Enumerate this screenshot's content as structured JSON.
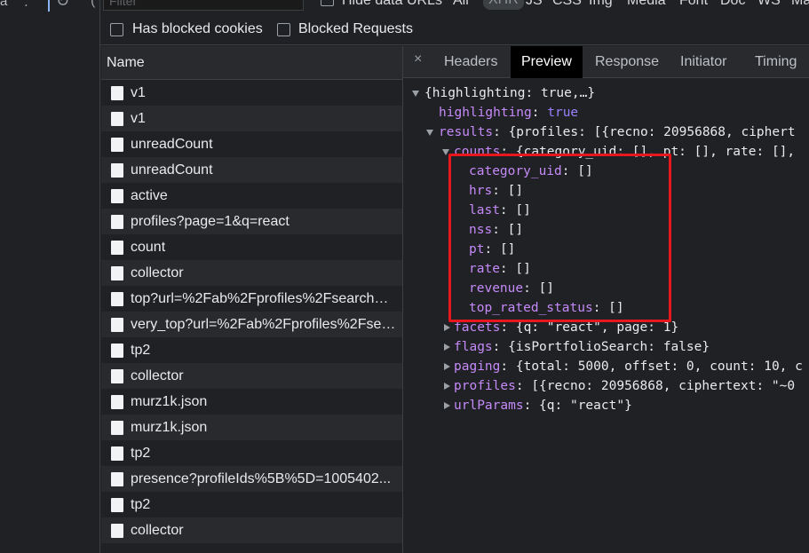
{
  "left_toolbar": {
    "text": "a",
    "dots": "⁚",
    "refresh_glyph": "↻",
    "extra_glyph": "("
  },
  "filter": {
    "placeholder": "Filter",
    "hide_data_urls_label": "Hide data URLs"
  },
  "type_filters": [
    "All",
    "XHR",
    "JS",
    "CSS",
    "Img",
    "Media",
    "Font",
    "Doc",
    "WS",
    "Ma"
  ],
  "active_type_filter": "XHR",
  "checkboxes": {
    "blocked_cookies": "Has blocked cookies",
    "blocked_requests": "Blocked Requests"
  },
  "name_column_header": "Name",
  "requests": [
    "v1",
    "v1",
    "unreadCount",
    "unreadCount",
    "active",
    "profiles?page=1&q=react",
    "count",
    "collector",
    "top?url=%2Fab%2Fprofiles%2Fsearch%...",
    "very_top?url=%2Fab%2Fprofiles%2Fsea...",
    "tp2",
    "collector",
    "murz1k.json",
    "murz1k.json",
    "tp2",
    "presence?profileIds%5B%5D=1005402...",
    "tp2",
    "collector"
  ],
  "detail_tabs": {
    "close": "×",
    "headers": "Headers",
    "preview": "Preview",
    "response": "Response",
    "initiator": "Initiator",
    "timing": "Timing"
  },
  "active_detail_tab": "Preview",
  "preview": {
    "root": "{highlighting: true,…}",
    "highlighting_key": "highlighting",
    "highlighting_value": "true",
    "results_key": "results",
    "results_value": "{profiles: [{recno: 20956868, ciphert",
    "counts_key": "counts",
    "counts_value": "{category_uid: [], pt: [], rate: [],",
    "count_fields": [
      {
        "key": "category_uid",
        "value": "[]"
      },
      {
        "key": "hrs",
        "value": "[]"
      },
      {
        "key": "last",
        "value": "[]"
      },
      {
        "key": "nss",
        "value": "[]"
      },
      {
        "key": "pt",
        "value": "[]"
      },
      {
        "key": "rate",
        "value": "[]"
      },
      {
        "key": "revenue",
        "value": "[]"
      },
      {
        "key": "top_rated_status",
        "value": "[]"
      }
    ],
    "facets_key": "facets",
    "facets_value": "{q: \"react\", page: 1}",
    "flags_key": "flags",
    "flags_value": "{isPortfolioSearch: false}",
    "paging_key": "paging",
    "paging_value": "{total: 5000, offset: 0, count: 10, c",
    "profiles_key": "profiles",
    "profiles_value": "[{recno: 20956868, ciphertext: \"~0",
    "urlparams_key": "urlParams",
    "urlparams_value": "{q: \"react\"}"
  },
  "colors": {
    "highlight_box": "#e8171e",
    "key": "#c58af9",
    "bool": "#9980ff",
    "background": "#202124"
  }
}
